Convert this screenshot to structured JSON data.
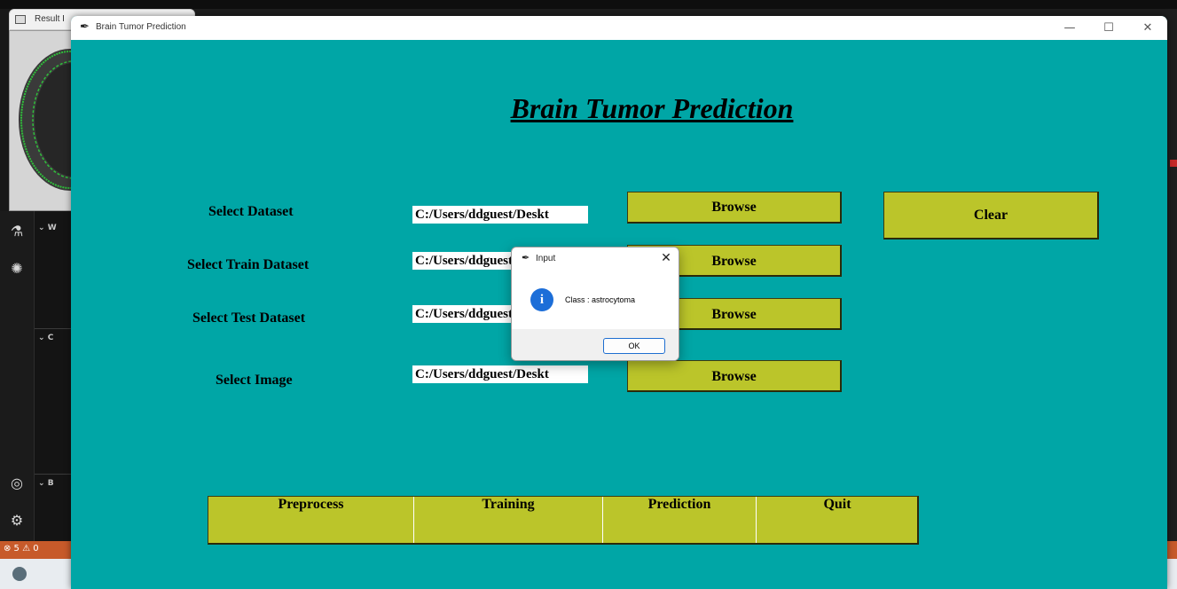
{
  "background": {
    "result_tab_label": "Result I",
    "panel_rows": [
      "W",
      "C",
      "B"
    ],
    "status": "⊗ 5 ⚠ 0",
    "status_color": "#c75a2a"
  },
  "window": {
    "title": "Brain Tumor Prediction",
    "controls": {
      "minimize": "—",
      "maximize": "☐",
      "close": "✕"
    },
    "bg_color": "#00a6a6"
  },
  "app": {
    "heading": "Brain Tumor Prediction",
    "button_color": "#bbc52a",
    "rows": [
      {
        "label": "Select Dataset",
        "path": "C:/Users/ddguest/Deskt",
        "button": "Browse"
      },
      {
        "label": "Select Train Dataset",
        "path": "C:/Users/ddguest/Deskt",
        "button": "Browse"
      },
      {
        "label": "Select Test Dataset",
        "path": "C:/Users/ddguest/Deskt",
        "button": "Browse"
      },
      {
        "label": "Select Image",
        "path": "C:/Users/ddguest/Deskt",
        "button": "Browse"
      }
    ],
    "clear_button": "Clear",
    "actions": [
      "Preprocess",
      "Training",
      "Prediction",
      "Quit"
    ]
  },
  "dialog": {
    "title": "Input",
    "message": "Class :  astrocytoma",
    "ok": "OK",
    "icon": "info-icon"
  }
}
